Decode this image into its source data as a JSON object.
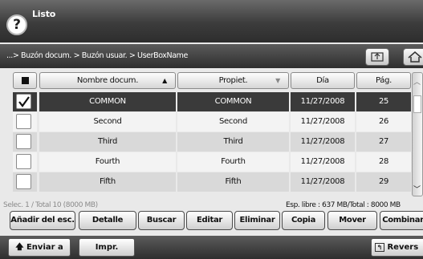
{
  "title": "Listo",
  "help_glyph": "?",
  "breadcrumb": "...> Buzón docum. > Buzón usuar. > UserBoxName",
  "table": {
    "headers": {
      "name": "Nombre docum.",
      "owner": "Propiet.",
      "day": "Día",
      "pages": "Pág."
    },
    "rows": [
      {
        "name": "COMMON",
        "owner": "COMMON",
        "day": "11/27/2008",
        "pages": "25",
        "selected": true
      },
      {
        "name": "Second",
        "owner": "Second",
        "day": "11/27/2008",
        "pages": "26",
        "selected": false
      },
      {
        "name": "Third",
        "owner": "Third",
        "day": "11/27/2008",
        "pages": "27",
        "selected": false
      },
      {
        "name": "Fourth",
        "owner": "Fourth",
        "day": "11/27/2008",
        "pages": "28",
        "selected": false
      },
      {
        "name": "Fifth",
        "owner": "Fifth",
        "day": "11/27/2008",
        "pages": "29",
        "selected": false
      }
    ]
  },
  "status": {
    "left": "Selec. 1 / Total 10 (8000 MB)",
    "right": "Esp. libre : 637 MB/Total : 8000 MB"
  },
  "actions": [
    "Añadir del esc.",
    "Detalle",
    "Buscar",
    "Editar",
    "Eliminar",
    "Copia",
    "Mover",
    "Combinar"
  ],
  "bottom": {
    "send": "Enviar a",
    "print": "Impr.",
    "reverse": "Revers"
  }
}
